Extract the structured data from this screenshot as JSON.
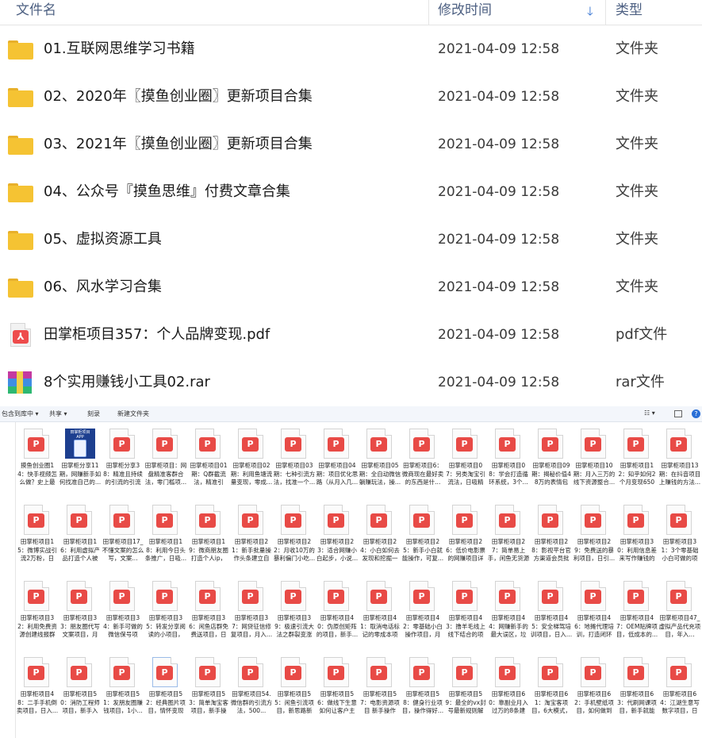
{
  "detail_view": {
    "columns": {
      "name": "文件名",
      "date": "修改时间",
      "type": "类型",
      "sort_icon": "arrow-down-icon"
    },
    "rows": [
      {
        "icon": "folder-icon",
        "name": "01.互联网思维学习书籍",
        "date": "2021-04-09 12:58",
        "type": "文件夹"
      },
      {
        "icon": "folder-icon",
        "name": "02、2020年〖摸鱼创业圈〗更新项目合集",
        "date": "2021-04-09 12:58",
        "type": "文件夹"
      },
      {
        "icon": "folder-icon",
        "name": "03、2021年〖摸鱼创业圈〗更新项目合集",
        "date": "2021-04-09 12:58",
        "type": "文件夹"
      },
      {
        "icon": "folder-icon",
        "name": "04、公众号『摸鱼思维』付费文章合集",
        "date": "2021-04-09 12:58",
        "type": "文件夹"
      },
      {
        "icon": "folder-icon",
        "name": "05、虚拟资源工具",
        "date": "2021-04-09 12:58",
        "type": "文件夹"
      },
      {
        "icon": "folder-icon",
        "name": "06、风水学习合集",
        "date": "2021-04-09 12:58",
        "type": "文件夹"
      },
      {
        "icon": "pdf-icon",
        "name": "田掌柜项目357：个人品牌变现.pdf",
        "date": "2021-04-09 12:58",
        "type": "pdf文件"
      },
      {
        "icon": "rar-icon",
        "name": "8个实用赚钱小工具02.rar",
        "date": "2021-04-09 12:58",
        "type": "rar文件"
      }
    ]
  },
  "thumb_view": {
    "toolbar": {
      "include": "包含到库中 ▾",
      "share": "共享 ▾",
      "burn": "刻录",
      "new_folder": "新建文件夹",
      "view": "☷ ▾"
    },
    "cover_text": "田掌柜项目 APP",
    "pdf_mark": "P",
    "tiles": [
      [
        "摸鱼创业圈14：快手视频怎么做？史上最强...",
        "田掌柜分享11期，网赚新手如何找准自己的...",
        "田掌柜分享38：精准且持续的引流的引流方...",
        "田掌柜项目：网盘精准客群合法，零门槛项...",
        "田掌柜项目01期：Q群截流法，精准引流，...",
        "田掌柜项目02期：利用鱼塘流量变现，零成...",
        "田掌柜项目03期：七种引流方法，找准一个...",
        "田掌柜项目04期：项目优化思路（从月入几...",
        "田掌柜项目05期：全自动微信躺赚玩法，操...",
        "田掌柜项目6：微商现在最好卖的东西是什...",
        "田掌柜项目07：另类淘宝引流法，日吸精准...",
        "田掌柜项目08：学会打造循环系统，3个...",
        "田掌柜项目09期：揭秘价值48万的表情包公...",
        "田掌柜项目10期：月入三万的线下资源整合...",
        "田掌柜项目12：知乎如何2个月变现650万...",
        "田掌柜项目13期：在抖音项目上赚钱的方法..."
      ],
      [
        "田掌柜项目15：微博实战引流2万粉，日入...",
        "田掌柜项目16：利用虚拟产品打造个人被动...",
        "田掌柜项目17_不懂文案的怎么写，文案...",
        "田掌柜项目18：利用今日头条推广，日吸...",
        "田掌柜项目19：微商朋友圈打造个人ip，提...",
        "田掌柜项目21：新手批量操作头条建立自动...",
        "田掌柜项目22：月收10万的暴利偏门小吃...",
        "田掌柜项目23：适合网赚小白起步，小说...",
        "田掌柜项目24：小白如何去发现和挖掘一个...",
        "田掌柜项目25：新手小白就能操作，可复...",
        "田掌柜项目26：低价电影票的网赚项目详解...",
        "田掌柜项目27：简单易上手，闲鱼无货源店...",
        "田掌柜项目28：影视平台官方渠道会员批发...",
        "田掌柜项目29：免费送的暴利项目，日引...",
        "田掌柜项目30：利用信息差来写作赚钱的项...",
        "田掌柜项目31：3个零基础小白可做的项目..."
      ],
      [
        "田掌柜项目32：利用免费资源创建线报群组...",
        "田掌柜项目33：朋友圈代写文案项目，月入...",
        "田掌柜项目34：新手可做的微信保号项目，...",
        "田掌柜项目35：转发分享阅读的小项目，日...",
        "田掌柜项目36：闲鱼店群免费送项目，日赚...",
        "田掌柜项目37：网贷征信修复项目，月入...",
        "田掌柜项目39：极速引流大法之群裂变涨粉...",
        "田掌柜项目40：伪原创矩阵的项目，新手...",
        "田掌柜项目41：取消电话标记的零成本项目...",
        "田掌柜项目42：零基础小白操作项目，月入...",
        "田掌柜项目43：撸羊毛线上线下结合的项目...",
        "田掌柜项目44：网赚新手的最大误区，垃圾...",
        "田掌柜项目45：安全梯驾培训项目，日入...",
        "田掌柜项目46：地摊代理培训，打造闭环系...",
        "田掌柜项目47：OEM贴牌项目，低成本的...",
        "田掌柜项目47_虚拟产品代充项目，年入..."
      ],
      [
        "田掌柜项目48：二手手机倒卖项目，日入...",
        "田掌柜项目50：消防工程师项目，新手入门...",
        "田掌柜项目51：发朋友圈赚钱项目，1小...",
        "田掌柜项目52：经典图片项目，情怀变现月...",
        "田掌柜项目53：简单淘宝客项目，新手操作...",
        "田掌柜项目54.微信群的引流方法，500...",
        "田掌柜项目55：闲鱼引流项目，新思路新玩...",
        "田掌柜项目56：做线下生意如何让客户主动...",
        "田掌柜项目57：电影资源项目 新手操作日...",
        "田掌柜项目58：健身行业项目，操作得好...",
        "田掌柜项目59：最全的vx封号最新规则解读...",
        "田掌柜项目60：靠副业月入过万的8条建议...",
        "田掌柜项目61：淘宝客项目，6大模式，双...",
        "田掌柜项目62：手机壁纸项目，如何做到日...",
        "田掌柜项目63：代刷网课项目，新手就能月...",
        "田掌柜项目64：江湖生意写数字项目，日入..."
      ]
    ]
  },
  "colors": {
    "folder": "#f5c333",
    "pdf_red": "#e84a46",
    "header_text": "#4d6082",
    "sort_arrow": "#2f6fd0"
  }
}
